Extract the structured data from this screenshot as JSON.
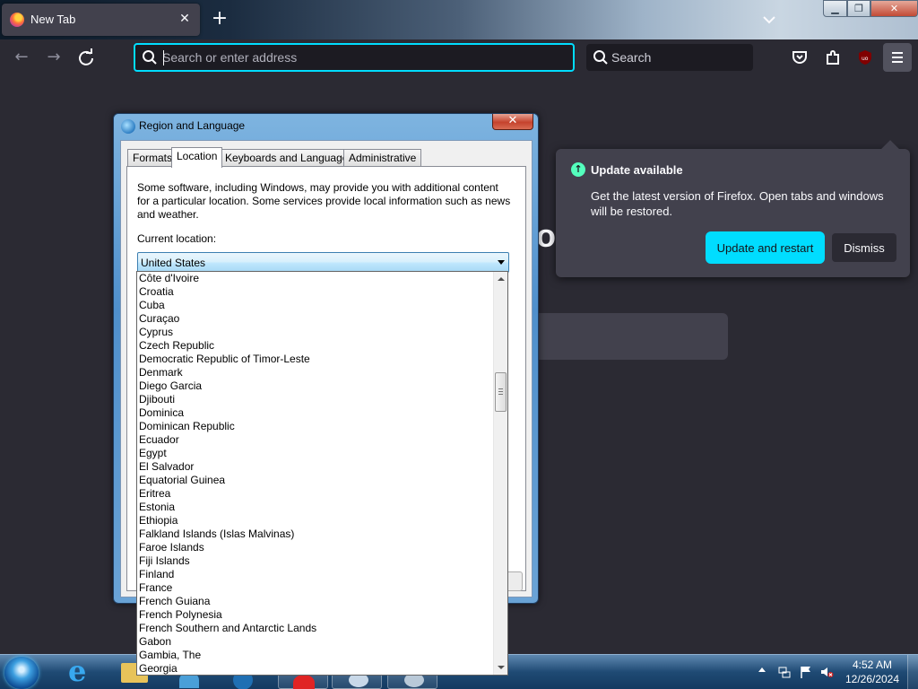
{
  "browser": {
    "tab_title": "New Tab",
    "address_placeholder": "Search or enter address",
    "search_label": "Search",
    "wordmark_fragment": "ox"
  },
  "update_panel": {
    "title": "Update available",
    "message": "Get the latest version of Firefox. Open tabs and windows will be restored.",
    "update_button": "Update and restart",
    "dismiss_button": "Dismiss"
  },
  "dialog": {
    "title": "Region and Language",
    "tabs": [
      "Formats",
      "Location",
      "Keyboards and Languages",
      "Administrative"
    ],
    "active_tab": "Location",
    "intro": "Some software, including Windows, may provide you with additional content for a particular location. Some services provide local information such as news and weather.",
    "current_location_label": "Current location:",
    "current_location_value": "United States"
  },
  "location_list": [
    "Côte d'Ivoire",
    "Croatia",
    "Cuba",
    "Curaçao",
    "Cyprus",
    "Czech Republic",
    "Democratic Republic of Timor-Leste",
    "Denmark",
    "Diego Garcia",
    "Djibouti",
    "Dominica",
    "Dominican Republic",
    "Ecuador",
    "Egypt",
    "El Salvador",
    "Equatorial Guinea",
    "Eritrea",
    "Estonia",
    "Ethiopia",
    "Falkland Islands (Islas Malvinas)",
    "Faroe Islands",
    "Fiji Islands",
    "Finland",
    "France",
    "French Guiana",
    "French Polynesia",
    "French Southern and Antarctic Lands",
    "Gabon",
    "Gambia, The",
    "Georgia"
  ],
  "taskbar": {
    "time": "4:52 AM",
    "date": "12/26/2024"
  },
  "colors": {
    "accent": "#00ddff",
    "browser_bg": "#2b2a33",
    "panel_bg": "#42414d",
    "update_icon": "#54ffbd"
  }
}
